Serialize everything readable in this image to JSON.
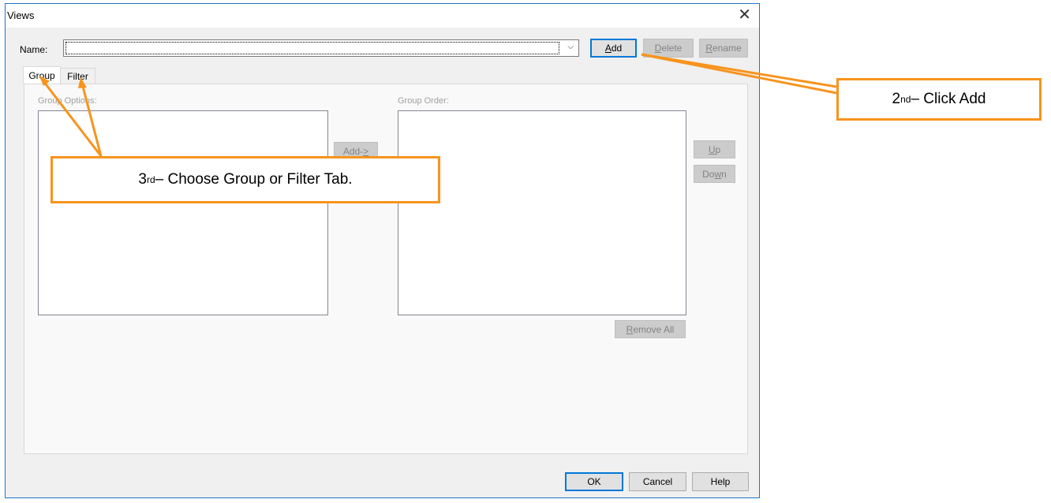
{
  "window": {
    "title": "Views",
    "close_glyph": "✕"
  },
  "name_row": {
    "label": "Name:",
    "value": "",
    "dropdown_glyph": "⌵"
  },
  "top_buttons": {
    "add": {
      "pre": "",
      "mn": "A",
      "post": "dd",
      "enabled": true
    },
    "delete": {
      "pre": "",
      "mn": "D",
      "post": "elete",
      "enabled": false
    },
    "rename": {
      "pre": "",
      "mn": "R",
      "post": "ename",
      "enabled": false
    }
  },
  "tabs": [
    {
      "label": "Group",
      "selected": true
    },
    {
      "label": "Filter",
      "selected": false
    }
  ],
  "group_options": {
    "label": "Group Options:"
  },
  "group_order": {
    "label": "Group Order:"
  },
  "mid_buttons": {
    "add_to": {
      "pre": "Add-",
      "mn": ">",
      "post": "",
      "enabled": false
    },
    "up": {
      "pre": "",
      "mn": "U",
      "post": "p",
      "enabled": false
    },
    "down": {
      "pre": "Do",
      "mn": "w",
      "post": "n",
      "enabled": false
    },
    "remove_all": {
      "pre": "",
      "mn": "R",
      "post": "emove All",
      "enabled": false
    }
  },
  "bottom_buttons": {
    "ok": {
      "label": "OK"
    },
    "cancel": {
      "label": "Cancel"
    },
    "help": {
      "label": "Help"
    }
  },
  "callouts": {
    "second": {
      "ord": "2",
      "sup": "nd",
      "text": " – Click Add"
    },
    "third": {
      "ord": "3",
      "sup": "rd",
      "text": " – Choose Group or Filter Tab."
    }
  },
  "colors": {
    "callout_border": "#f7941d",
    "window_border": "#1f74c9",
    "default_button": "#0078d7"
  }
}
